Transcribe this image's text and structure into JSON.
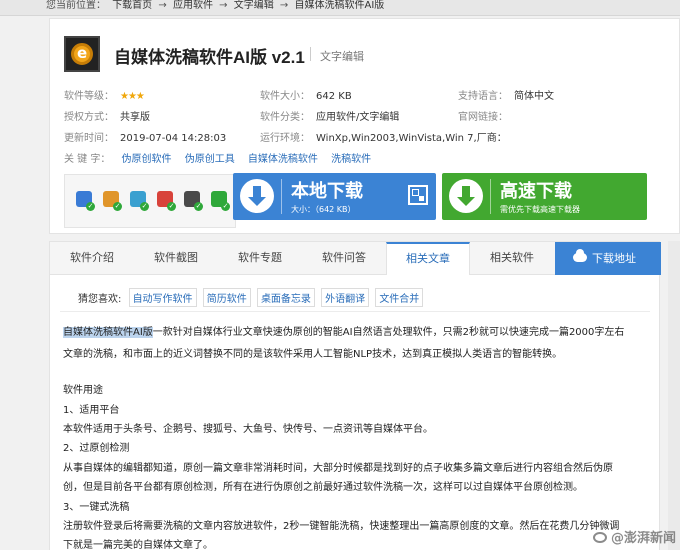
{
  "breadcrumb": {
    "prefix": "您当前位置：",
    "items": [
      "下载首页",
      "应用软件",
      "文字编辑",
      "自媒体洗稿软件AI版"
    ],
    "sep": "→"
  },
  "software": {
    "title": "自媒体洗稿软件AI版 v2.1",
    "category_tag": "文字编辑",
    "rating_label": "软件等级：",
    "rating_stars": "★★★",
    "size_label": "软件大小：",
    "size": "642 KB",
    "lang_label": "支持语言：",
    "lang": "简体中文",
    "license_label": "授权方式：",
    "license": "共享版",
    "category_label": "软件分类：",
    "category": "应用软件/文字编辑",
    "site_label": "官网链接：",
    "site": "",
    "update_label": "更新时间：",
    "update": "2019-07-04 14:28:03",
    "env_label": "运行环境：",
    "env": "WinXp,Win2003,WinVista,Win 7,厂商：",
    "keywords_label": "关 键 字：",
    "keywords": [
      "伪原创软件",
      "伪原创工具",
      "自媒体洗稿软件",
      "洗稿软件"
    ]
  },
  "security_icons": [
    "shield-icon",
    "robot-icon",
    "scan-icon",
    "kaspersky-icon",
    "lock-icon",
    "check-shield-icon"
  ],
  "download": {
    "local_label": "本地下载",
    "local_size": "大小：（642 KB）",
    "fast_label": "高速下载",
    "fast_sub": "需优先下载高速下载器"
  },
  "tabs": [
    "软件介绍",
    "软件截图",
    "软件专题",
    "软件问答",
    "相关文章",
    "相关软件"
  ],
  "active_tab": "相关文章",
  "download_tab": "下载地址",
  "guess": {
    "label": "猜您喜欢:",
    "tags": [
      "自动写作软件",
      "简历软件",
      "桌面备忘录",
      "外语翻译",
      "文件合并"
    ]
  },
  "article": {
    "intro_highlight": "自媒体洗稿软件AI版",
    "intro_rest": "一款针对自媒体行业文章快速伪原创的智能AI自然语言处理软件，只需2秒就可以快速完成一篇2000字左右",
    "intro_line2": "文章的洗稿，和市面上的近义词替换不同的是该软件采用人工智能NLP技术，达到真正模拟人类语言的智能转换。",
    "usage_title": "软件用途",
    "s1_title": "1、适用平台",
    "s1_body": "本软件适用于头条号、企鹅号、搜狐号、大鱼号、快传号、一点资讯等自媒体平台。",
    "s2_title": "2、过原创检测",
    "s2_body1": "从事自媒体的编辑都知道，原创一篇文章非常消耗时间，大部分时候都是找到好的点子收集多篇文章后进行内容组合然后伪原",
    "s2_body2": "创，但是目前各平台都有原创检测，所有在进行伪原创之前最好通过软件洗稿一次，这样可以过自媒体平台原创检测。",
    "s3_title": "3、一键式洗稿",
    "s3_body1": "注册软件登录后将需要洗稿的文章内容放进软件，2秒一键智能洗稿，快速整理出一篇高原创度的文章。然后在花费几分钟微调",
    "s3_body2": "下就是一篇完美的自媒体文章了。"
  },
  "watermark": "@澎湃新闻"
}
